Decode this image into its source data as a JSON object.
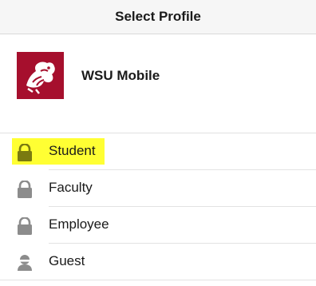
{
  "navbar": {
    "title": "Select Profile"
  },
  "header": {
    "app_name": "WSU Mobile",
    "logo_icon": "wsu-cougar-logo",
    "logo_color": "#a60f2d"
  },
  "profiles": [
    {
      "label": "Student",
      "icon": "lock-icon",
      "highlighted": true
    },
    {
      "label": "Faculty",
      "icon": "lock-icon",
      "highlighted": false
    },
    {
      "label": "Employee",
      "icon": "lock-icon",
      "highlighted": false
    },
    {
      "label": "Guest",
      "icon": "person-icon",
      "highlighted": false
    }
  ],
  "colors": {
    "highlight": "#ffff33",
    "icon": "#8c8c8c",
    "icon_highlighted": "#7a7a10"
  }
}
